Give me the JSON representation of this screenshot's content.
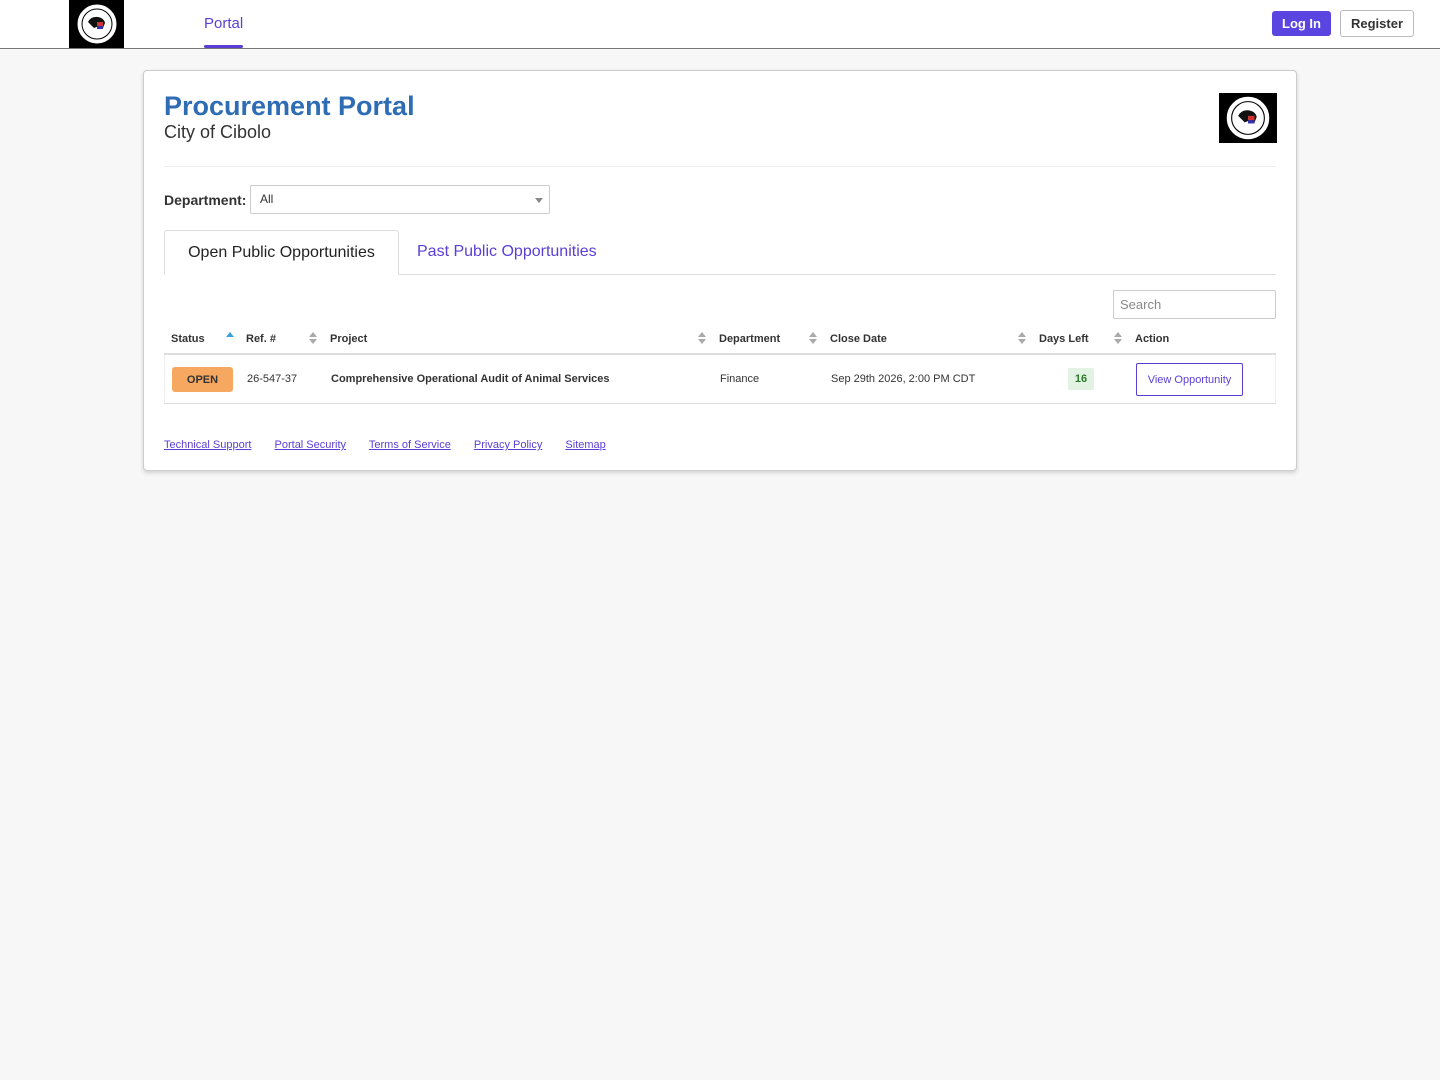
{
  "topbar": {
    "nav_portal": "Portal",
    "login_label": "Log In",
    "register_label": "Register"
  },
  "header": {
    "title": "Procurement Portal",
    "subtitle": "City of Cibolo"
  },
  "filter": {
    "department_label": "Department:",
    "department_value": "All"
  },
  "tabs": {
    "open": "Open Public Opportunities",
    "past": "Past Public Opportunities"
  },
  "search": {
    "placeholder": "Search"
  },
  "table": {
    "columns": {
      "status": "Status",
      "ref": "Ref. #",
      "project": "Project",
      "department": "Department",
      "close_date": "Close Date",
      "days_left": "Days Left",
      "action": "Action"
    },
    "rows": [
      {
        "status": "OPEN",
        "ref": "26-547-37",
        "project": "Comprehensive Operational Audit of Animal Services",
        "department": "Finance",
        "close_date": "Sep 29th 2026, 2:00 PM CDT",
        "days_left": "16",
        "action": "View Opportunity"
      }
    ]
  },
  "footer": {
    "links": [
      "Technical Support",
      "Portal Security",
      "Terms of Service",
      "Privacy Policy",
      "Sitemap"
    ]
  },
  "colors": {
    "brand": "#5a3fd6",
    "title": "#2e6db4",
    "status_open": "#f7a860",
    "days_badge_bg": "#e3f3e3"
  }
}
